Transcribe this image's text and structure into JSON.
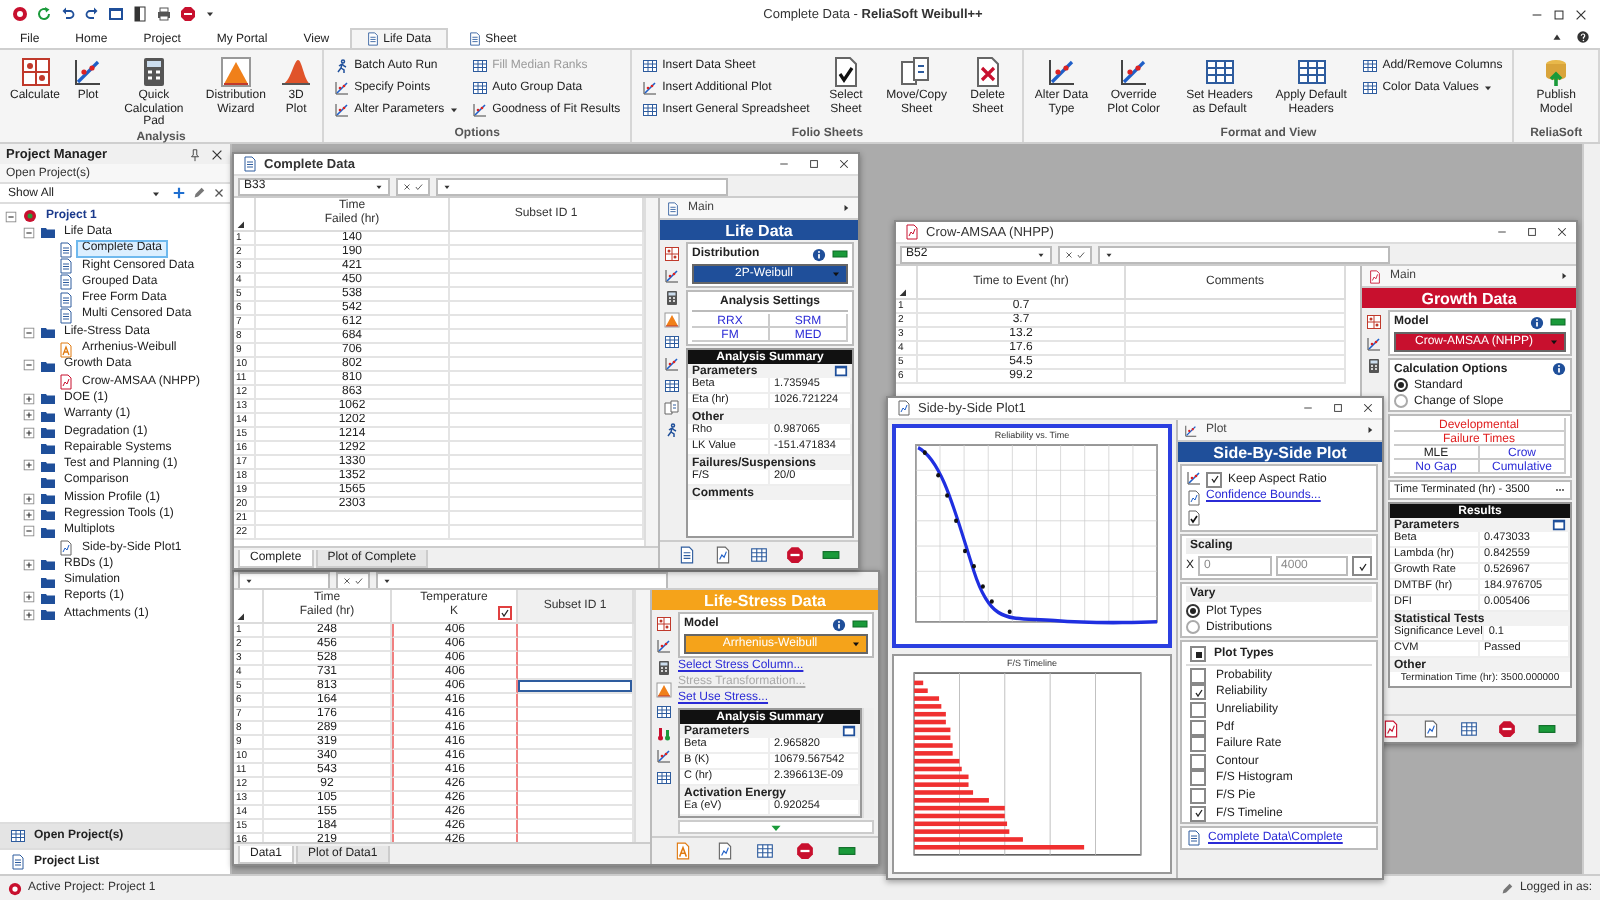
{
  "window": {
    "title": "Complete Data - **ReliaSoft Weibull++**"
  },
  "ribbon": {
    "tabs": [
      {
        "label": "File",
        "selected": false,
        "kind": "main"
      },
      {
        "label": "Home",
        "selected": false,
        "kind": "main"
      },
      {
        "label": "Project",
        "selected": false,
        "kind": "main"
      },
      {
        "label": "My Portal",
        "selected": false,
        "kind": "main"
      },
      {
        "label": "View",
        "selected": false,
        "kind": "main"
      },
      {
        "label": "Life Data",
        "selected": true,
        "kind": "context"
      },
      {
        "label": "Sheet",
        "selected": false,
        "kind": "context"
      }
    ],
    "groups": [
      {
        "label": "Analysis",
        "items": [
          {
            "label": "Calculate",
            "kind": "large",
            "disabled": false
          },
          {
            "label": "Plot",
            "kind": "large",
            "disabled": false
          },
          {
            "label": "Quick Calculation Pad",
            "kind": "large",
            "disabled": false
          },
          {
            "label": "Distribution Wizard",
            "kind": "large",
            "disabled": false
          },
          {
            "label": "3D Plot",
            "kind": "large",
            "disabled": false
          }
        ]
      },
      {
        "label": "Options",
        "items": [
          {
            "label": "Batch Auto Run",
            "kind": "small",
            "disabled": false
          },
          {
            "label": "Specify Points",
            "kind": "small",
            "disabled": false
          },
          {
            "label": "Alter Parameters",
            "kind": "menu",
            "disabled": false
          },
          {
            "label": "Fill Median Ranks",
            "kind": "small",
            "disabled": true
          },
          {
            "label": "Auto Group Data",
            "kind": "small",
            "disabled": false
          },
          {
            "label": "Goodness of Fit Results",
            "kind": "small",
            "disabled": false
          }
        ]
      },
      {
        "label": "Folio Sheets",
        "items": [
          {
            "label": "Insert Data Sheet",
            "kind": "small",
            "disabled": false
          },
          {
            "label": "Insert Additional Plot",
            "kind": "small",
            "disabled": false
          },
          {
            "label": "Insert General Spreadsheet",
            "kind": "small",
            "disabled": false
          },
          {
            "label": "Select Sheet",
            "kind": "large",
            "disabled": false
          },
          {
            "label": "Move/Copy Sheet",
            "kind": "large",
            "disabled": false
          },
          {
            "label": "Delete Sheet",
            "kind": "large",
            "disabled": false
          }
        ]
      },
      {
        "label": "Format and View",
        "items": [
          {
            "label": "Alter Data Type",
            "kind": "large",
            "disabled": false
          },
          {
            "label": "Override Plot Color",
            "kind": "large",
            "disabled": false
          },
          {
            "label": "Set Headers as Default",
            "kind": "large",
            "disabled": false
          },
          {
            "label": "Apply Default Headers",
            "kind": "large",
            "disabled": false
          },
          {
            "label": "Add/Remove Columns",
            "kind": "small",
            "disabled": false
          },
          {
            "label": "Color Data Values",
            "kind": "menu",
            "disabled": false
          }
        ]
      },
      {
        "label": "ReliaSoft",
        "items": [
          {
            "label": "Publish Model",
            "kind": "large",
            "disabled": false
          }
        ]
      }
    ]
  },
  "project_manager": {
    "title": "Project Manager",
    "open_projects": "Open Project(s)",
    "filter": "Show All",
    "tree": [
      {
        "label": "Project 1",
        "kind": "project",
        "expanded": true,
        "selected": false,
        "children": [
          {
            "label": "Life Data",
            "kind": "folder",
            "expanded": true,
            "selected": false,
            "children": [
              {
                "label": "Complete Data",
                "kind": "life",
                "selected": true
              },
              {
                "label": "Right Censored Data",
                "kind": "life",
                "selected": false
              },
              {
                "label": "Grouped Data",
                "kind": "life",
                "selected": false
              },
              {
                "label": "Free Form Data",
                "kind": "life",
                "selected": false
              },
              {
                "label": "Multi Censored Data",
                "kind": "life",
                "selected": false
              }
            ]
          },
          {
            "label": "Life-Stress Data",
            "kind": "folder",
            "expanded": true,
            "selected": false,
            "children": [
              {
                "label": "Arrhenius-Weibull",
                "kind": "stress",
                "selected": false
              }
            ]
          },
          {
            "label": "Growth Data",
            "kind": "folder",
            "expanded": true,
            "selected": false,
            "children": [
              {
                "label": "Crow-AMSAA (NHPP)",
                "kind": "growth",
                "selected": false
              }
            ]
          },
          {
            "label": "DOE (1)",
            "kind": "folder",
            "expanded": false,
            "selected": false
          },
          {
            "label": "Warranty (1)",
            "kind": "folder",
            "expanded": false,
            "selected": false
          },
          {
            "label": "Degradation (1)",
            "kind": "folder",
            "expanded": false,
            "selected": false
          },
          {
            "label": "Repairable Systems",
            "kind": "folder",
            "selected": false
          },
          {
            "label": "Test and Planning (1)",
            "kind": "folder",
            "expanded": false,
            "selected": false
          },
          {
            "label": "Comparison",
            "kind": "folder",
            "selected": false
          },
          {
            "label": "Mission Profile (1)",
            "kind": "folder",
            "expanded": false,
            "selected": false
          },
          {
            "label": "Regression Tools (1)",
            "kind": "folder",
            "expanded": false,
            "selected": false
          },
          {
            "label": "Multiplots",
            "kind": "folder",
            "expanded": true,
            "selected": false,
            "children": [
              {
                "label": "Side-by-Side Plot1",
                "kind": "plot",
                "selected": false
              }
            ]
          },
          {
            "label": "RBDs (1)",
            "kind": "folder",
            "expanded": false,
            "selected": false
          },
          {
            "label": "Simulation",
            "kind": "folder",
            "selected": false
          },
          {
            "label": "Reports (1)",
            "kind": "folder",
            "expanded": false,
            "selected": false
          },
          {
            "label": "Attachments (1)",
            "kind": "folder",
            "expanded": false,
            "selected": false
          }
        ]
      }
    ],
    "bottom_items": [
      {
        "label": "Open Project(s)",
        "selected": true
      },
      {
        "label": "Project List",
        "selected": false
      }
    ]
  },
  "complete_data": {
    "title": "Complete Data",
    "cell_ref": "B33",
    "columns": [
      {
        "label": "Time\nFailed (hr)",
        "checked": false
      },
      {
        "label": "Subset ID 1",
        "checked": false
      }
    ],
    "rows": [
      {
        "num": "1",
        "cells": [
          "140"
        ]
      },
      {
        "num": "2",
        "cells": [
          "190"
        ]
      },
      {
        "num": "3",
        "cells": [
          "421"
        ]
      },
      {
        "num": "4",
        "cells": [
          "450"
        ]
      },
      {
        "num": "5",
        "cells": [
          "538"
        ]
      },
      {
        "num": "6",
        "cells": [
          "542"
        ]
      },
      {
        "num": "7",
        "cells": [
          "612"
        ]
      },
      {
        "num": "8",
        "cells": [
          "684"
        ]
      },
      {
        "num": "9",
        "cells": [
          "706"
        ]
      },
      {
        "num": "10",
        "cells": [
          "802"
        ]
      },
      {
        "num": "11",
        "cells": [
          "810"
        ]
      },
      {
        "num": "12",
        "cells": [
          "863"
        ]
      },
      {
        "num": "13",
        "cells": [
          "1062"
        ]
      },
      {
        "num": "14",
        "cells": [
          "1202"
        ]
      },
      {
        "num": "15",
        "cells": [
          "1214"
        ]
      },
      {
        "num": "16",
        "cells": [
          "1292"
        ]
      },
      {
        "num": "17",
        "cells": [
          "1330"
        ]
      },
      {
        "num": "18",
        "cells": [
          "1352"
        ]
      },
      {
        "num": "19",
        "cells": [
          "1565"
        ]
      },
      {
        "num": "20",
        "cells": [
          "2303"
        ]
      },
      {
        "num": "21",
        "cells": []
      },
      {
        "num": "22",
        "cells": []
      }
    ],
    "sheet_tabs": [
      {
        "label": "Complete",
        "selected": true
      },
      {
        "label": "Plot of Complete",
        "selected": false
      }
    ],
    "panel": {
      "header": "Main",
      "title": "Life Data",
      "model_label": "Distribution",
      "model": "2P-Weibull",
      "settings_title": "Analysis Settings",
      "settings": [
        "RRX",
        "SRM",
        "FM",
        "MED"
      ],
      "summary_title": "Analysis Summary",
      "summary": [
        {
          "kind": "heading",
          "label": "Parameters"
        },
        {
          "kind": "row",
          "label": "Beta",
          "value": "1.735945"
        },
        {
          "kind": "row",
          "label": "Eta (hr)",
          "value": "1026.721224"
        },
        {
          "kind": "heading",
          "label": "Other"
        },
        {
          "kind": "row",
          "label": "Rho",
          "value": "0.987065"
        },
        {
          "kind": "row",
          "label": "LK Value",
          "value": "-151.471834"
        },
        {
          "kind": "heading",
          "label": "Failures/Suspensions"
        },
        {
          "kind": "row",
          "label": "F/S",
          "value": "20/0"
        },
        {
          "kind": "heading",
          "label": "Comments"
        }
      ]
    }
  },
  "life_stress": {
    "columns": [
      {
        "label": "Time\nFailed (hr)",
        "kind": "data",
        "checked": false
      },
      {
        "label": "Temperature\nK",
        "kind": "stress",
        "checked": true
      },
      {
        "label": "Subset ID 1",
        "kind": "data",
        "checked": false
      }
    ],
    "rows": [
      {
        "num": "1",
        "cells": [
          "248",
          "406"
        ],
        "focused": false
      },
      {
        "num": "2",
        "cells": [
          "456",
          "406"
        ],
        "focused": false
      },
      {
        "num": "3",
        "cells": [
          "528",
          "406"
        ],
        "focused": false
      },
      {
        "num": "4",
        "cells": [
          "731",
          "406"
        ],
        "focused": false
      },
      {
        "num": "5",
        "cells": [
          "813",
          "406"
        ],
        "focused": true
      },
      {
        "num": "6",
        "cells": [
          "164",
          "416"
        ],
        "focused": false
      },
      {
        "num": "7",
        "cells": [
          "176",
          "416"
        ],
        "focused": false
      },
      {
        "num": "8",
        "cells": [
          "289",
          "416"
        ],
        "focused": false
      },
      {
        "num": "9",
        "cells": [
          "319",
          "416"
        ],
        "focused": false
      },
      {
        "num": "10",
        "cells": [
          "340",
          "416"
        ],
        "focused": false
      },
      {
        "num": "11",
        "cells": [
          "543",
          "416"
        ],
        "focused": false
      },
      {
        "num": "12",
        "cells": [
          "92",
          "426"
        ],
        "focused": false
      },
      {
        "num": "13",
        "cells": [
          "105",
          "426"
        ],
        "focused": false
      },
      {
        "num": "14",
        "cells": [
          "155",
          "426"
        ],
        "focused": false
      },
      {
        "num": "15",
        "cells": [
          "184",
          "426"
        ],
        "focused": false
      },
      {
        "num": "16",
        "cells": [
          "219",
          "426"
        ],
        "focused": false
      }
    ],
    "sheet_tabs": [
      {
        "label": "Data1",
        "selected": true
      },
      {
        "label": "Plot of Data1",
        "selected": false
      }
    ],
    "panel": {
      "title": "Life-Stress Data",
      "model_label": "Model",
      "model": "Arrhenius-Weibull",
      "links": [
        {
          "label": "Select Stress Column...",
          "disabled": false
        },
        {
          "label": "Stress Transformation...",
          "disabled": true
        },
        {
          "label": "Set Use Stress...",
          "disabled": false
        }
      ],
      "summary_title": "Analysis Summary",
      "summary": [
        {
          "kind": "heading",
          "label": "Parameters"
        },
        {
          "kind": "row",
          "label": "Beta",
          "value": "2.965820"
        },
        {
          "kind": "row",
          "label": "B (K)",
          "value": "10679.567542"
        },
        {
          "kind": "row",
          "label": "C (hr)",
          "value": "2.396613E-09"
        },
        {
          "kind": "heading",
          "label": "Activation Energy"
        },
        {
          "kind": "row",
          "label": "Ea (eV)",
          "value": "0.920254"
        }
      ]
    }
  },
  "growth": {
    "title": "Crow-AMSAA (NHPP)",
    "cell_ref": "B52",
    "columns": [
      {
        "label": "Time to Event (hr)",
        "checked": false
      },
      {
        "label": "Comments",
        "checked": false
      }
    ],
    "rows": [
      {
        "num": "1",
        "cells": [
          "0.7"
        ]
      },
      {
        "num": "2",
        "cells": [
          "3.7"
        ]
      },
      {
        "num": "3",
        "cells": [
          "13.2"
        ]
      },
      {
        "num": "4",
        "cells": [
          "17.6"
        ]
      },
      {
        "num": "5",
        "cells": [
          "54.5"
        ]
      },
      {
        "num": "6",
        "cells": [
          "99.2"
        ]
      }
    ],
    "panel": {
      "header": "Main",
      "title": "Growth Data",
      "model_label": "Model",
      "model": "Crow-AMSAA (NHPP)",
      "calc_title": "Calculation Options",
      "calc_options": [
        {
          "label": "Standard",
          "selected": true
        },
        {
          "label": "Change of Slope",
          "selected": false
        }
      ],
      "settings": [
        {
          "label": "Developmental",
          "kind": "wide"
        },
        {
          "label": "Failure Times",
          "kind": "wide"
        },
        {
          "label": "MLE",
          "kind": "plain"
        },
        {
          "label": "Crow",
          "kind": "link"
        },
        {
          "label": "No Gap",
          "kind": "link"
        },
        {
          "label": "Cumulative",
          "kind": "link"
        }
      ],
      "terminated": "Time Terminated (hr) - 3500",
      "results_title": "Results",
      "results": [
        {
          "kind": "heading",
          "label": "Parameters"
        },
        {
          "kind": "row",
          "label": "Beta",
          "value": "0.473033"
        },
        {
          "kind": "row",
          "label": "Lambda (hr)",
          "value": "0.842559"
        },
        {
          "kind": "row",
          "label": "Growth Rate",
          "value": "0.526967"
        },
        {
          "kind": "row",
          "label": "DMTBF (hr)",
          "value": "184.976705"
        },
        {
          "kind": "row",
          "label": "DFI",
          "value": "0.005406"
        },
        {
          "kind": "heading",
          "label": "Statistical Tests"
        },
        {
          "kind": "row",
          "label": "Significance Level",
          "value": "0.1"
        },
        {
          "kind": "row",
          "label": "CVM",
          "value": "Passed"
        },
        {
          "kind": "heading",
          "label": "Other"
        },
        {
          "kind": "note",
          "label": "Termination Time (hr): 3500.000000"
        }
      ]
    }
  },
  "side_by_side": {
    "title": "Side-by-Side Plot1",
    "plots": [
      {
        "title": "Reliability vs. Time",
        "kind": "curve",
        "selected": true
      },
      {
        "title": "F/S Timeline",
        "kind": "timeline",
        "selected": false
      }
    ],
    "panel": {
      "header": "Plot",
      "title": "Side-By-Side Plot",
      "keep_aspect": {
        "label": "Keep Aspect Ratio",
        "checked": true
      },
      "bounds_link": "Confidence Bounds...",
      "scaling": {
        "title": "Scaling",
        "axis": "X",
        "min": "0",
        "max": "4000"
      },
      "vary": {
        "title": "Vary",
        "options": [
          {
            "label": "Plot Types",
            "selected": true
          },
          {
            "label": "Distributions",
            "selected": false
          }
        ]
      },
      "plot_types": {
        "title": "Plot Types",
        "mixed": true,
        "items": [
          {
            "label": "Probability",
            "checked": false
          },
          {
            "label": "Reliability",
            "checked": true
          },
          {
            "label": "Unreliability",
            "checked": false
          },
          {
            "label": "Pdf",
            "checked": false
          },
          {
            "label": "Failure Rate",
            "checked": false
          },
          {
            "label": "Contour",
            "checked": false
          },
          {
            "label": "F/S Histogram",
            "checked": false
          },
          {
            "label": "F/S Pie",
            "checked": false
          },
          {
            "label": "F/S Timeline",
            "checked": true
          }
        ]
      },
      "source_link": "Complete Data\\Complete"
    }
  },
  "status_bar": {
    "active_project": "Active Project: Project 1",
    "login": "Logged in as:"
  }
}
